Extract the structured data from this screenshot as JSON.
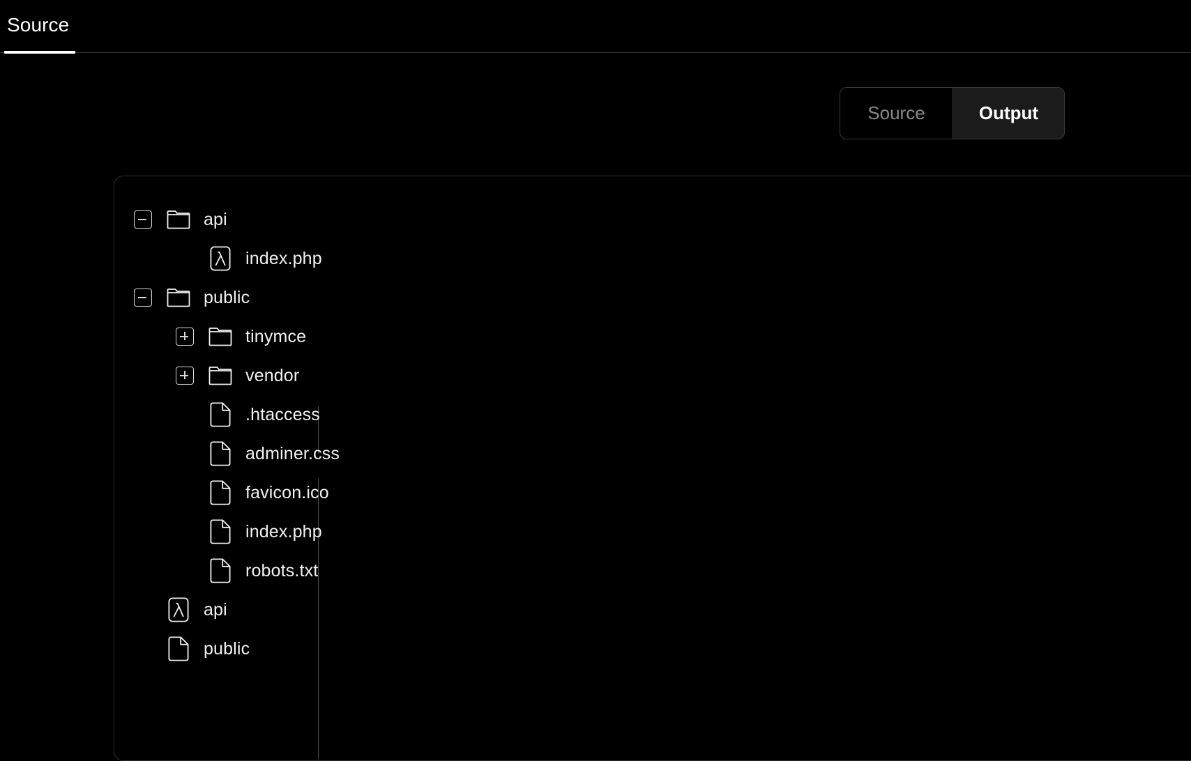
{
  "header": {
    "tabs": [
      {
        "label": "Source",
        "active": true
      }
    ]
  },
  "view_toggle": {
    "options": [
      {
        "label": "Source",
        "active": false
      },
      {
        "label": "Output",
        "active": true
      }
    ]
  },
  "file_tree": {
    "nodes": [
      {
        "label": "api",
        "icon": "folder-open-icon",
        "type": "folder",
        "depth": 0,
        "expander": "minus"
      },
      {
        "label": "index.php",
        "icon": "lambda-file-icon",
        "type": "function",
        "depth": 1,
        "expander": "none"
      },
      {
        "label": "public",
        "icon": "folder-open-icon",
        "type": "folder",
        "depth": 0,
        "expander": "minus"
      },
      {
        "label": "tinymce",
        "icon": "folder-icon",
        "type": "folder",
        "depth": 1,
        "expander": "plus"
      },
      {
        "label": "vendor",
        "icon": "folder-icon",
        "type": "folder",
        "depth": 1,
        "expander": "plus"
      },
      {
        "label": ".htaccess",
        "icon": "file-icon",
        "type": "file",
        "depth": 1,
        "expander": "none"
      },
      {
        "label": "adminer.css",
        "icon": "file-icon",
        "type": "file",
        "depth": 1,
        "expander": "none"
      },
      {
        "label": "favicon.ico",
        "icon": "file-icon",
        "type": "file",
        "depth": 1,
        "expander": "none"
      },
      {
        "label": "index.php",
        "icon": "file-icon",
        "type": "file",
        "depth": 1,
        "expander": "none"
      },
      {
        "label": "robots.txt",
        "icon": "file-icon",
        "type": "file",
        "depth": 1,
        "expander": "none"
      },
      {
        "label": "api",
        "icon": "lambda-file-icon",
        "type": "function",
        "depth": 0,
        "expander": "none"
      },
      {
        "label": "public",
        "icon": "file-icon",
        "type": "file",
        "depth": 0,
        "expander": "none"
      }
    ]
  },
  "colors": {
    "background": "#000000",
    "text": "#f2f2f2",
    "muted_text": "#8a8a8a",
    "border": "#2e2e2e",
    "accent": "#ffffff",
    "active_segment_bg": "#1b1b1b"
  }
}
